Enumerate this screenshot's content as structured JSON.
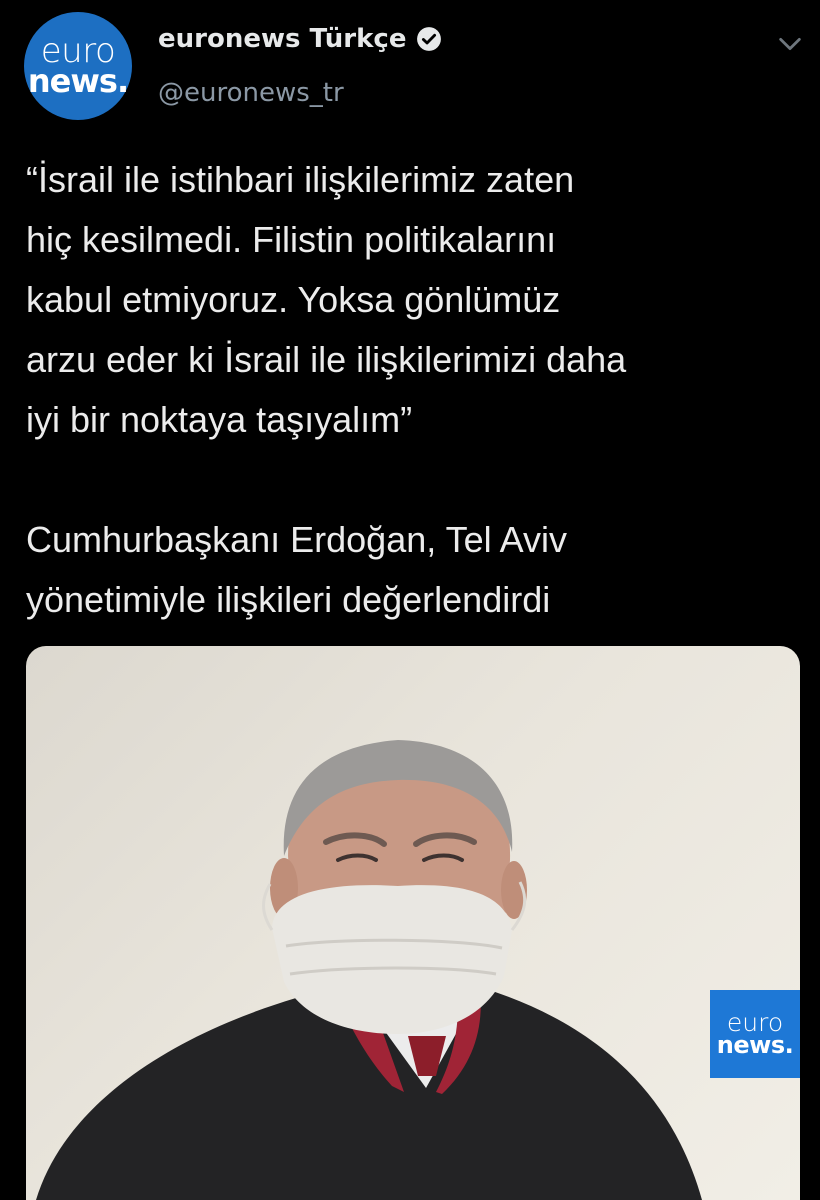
{
  "account": {
    "display_name": "euronews Türkçe",
    "handle": "@euronews_tr",
    "avatar_line1": "euro",
    "avatar_line2": "news.",
    "verified": true,
    "brand_color": "#1d6fc2"
  },
  "tweet": {
    "quote_lines": [
      "“İsrail ile istihbari ilişkilerimiz zaten",
      "hiç kesilmedi. Filistin politikalarını",
      "kabul etmiyoruz. Yoksa gönlümüz",
      "arzu eder ki İsrail ile ilişkilerimizi daha",
      "iyi bir noktaya taşıyalım”"
    ],
    "headline_lines": [
      "Cumhurbaşkanı Erdoğan, Tel Aviv",
      "yönetimiyle ilişkileri değerlendirdi"
    ]
  },
  "media": {
    "watermark_line1": "euro",
    "watermark_line2": "news.",
    "watermark_color": "#1e78d6"
  },
  "icons": {
    "verified": "verified-badge-icon",
    "menu": "chevron-down-icon"
  }
}
